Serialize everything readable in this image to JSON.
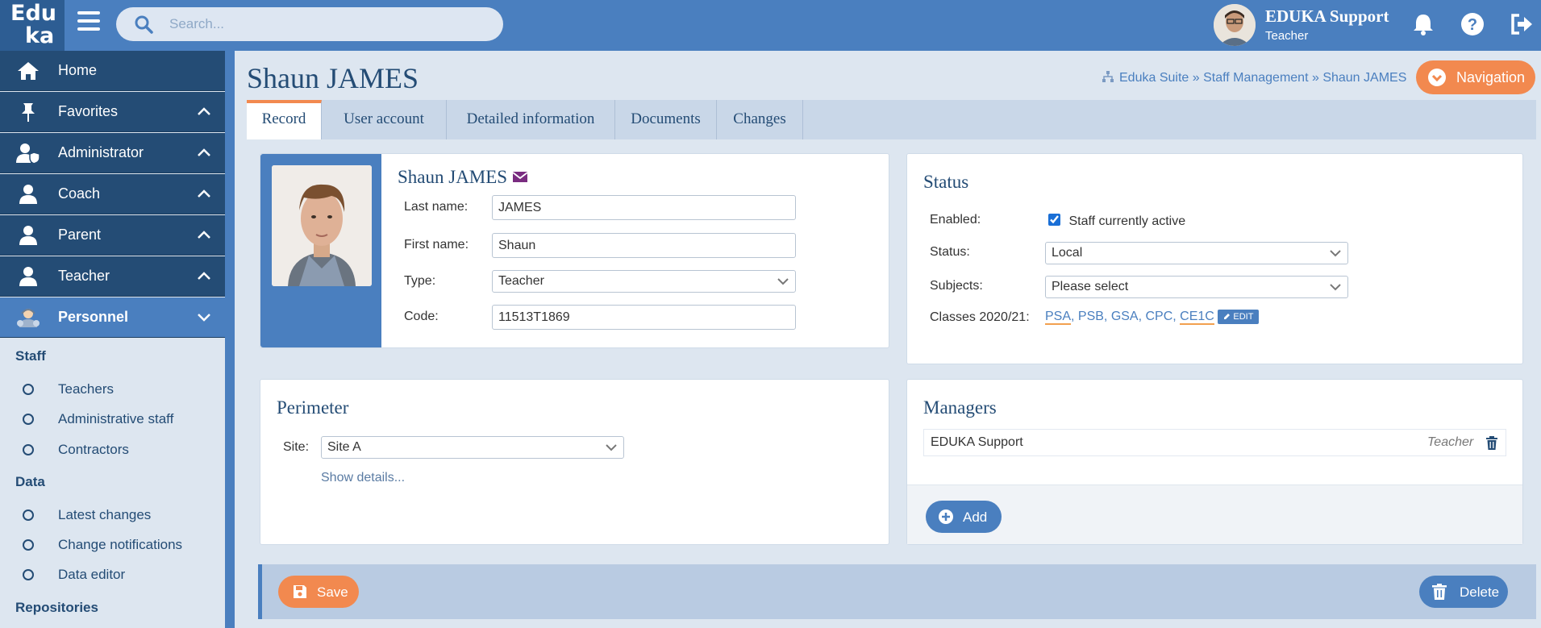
{
  "logo": {
    "line1": "Edu",
    "line2": "ka"
  },
  "search": {
    "placeholder": "Search..."
  },
  "user": {
    "name": "EDUKA Support",
    "role": "Teacher"
  },
  "sidebar": {
    "items": [
      {
        "label": "Home",
        "icon": "home-icon"
      },
      {
        "label": "Favorites",
        "icon": "pin-icon"
      },
      {
        "label": "Administrator",
        "icon": "user-shield-icon"
      },
      {
        "label": "Coach",
        "icon": "user-icon"
      },
      {
        "label": "Parent",
        "icon": "user-icon"
      },
      {
        "label": "Teacher",
        "icon": "user-icon"
      },
      {
        "label": "Personnel",
        "icon": "personnel-icon"
      }
    ],
    "groups": {
      "staff": "Staff",
      "data": "Data",
      "repositories": "Repositories"
    },
    "staff_items": [
      "Teachers",
      "Administrative staff",
      "Contractors"
    ],
    "data_items": [
      "Latest changes",
      "Change notifications",
      "Data editor"
    ]
  },
  "page": {
    "title": "Shaun JAMES"
  },
  "breadcrumb": "Eduka Suite » Staff Management » Shaun JAMES",
  "navigation_button": "Navigation",
  "tabs": [
    "Record",
    "User account",
    "Detailed information",
    "Documents",
    "Changes"
  ],
  "record": {
    "name": "Shaun JAMES",
    "last_name_label": "Last name:",
    "last_name": "JAMES",
    "first_name_label": "First name:",
    "first_name": "Shaun",
    "type_label": "Type:",
    "type": "Teacher",
    "code_label": "Code:",
    "code": "11513T1869"
  },
  "status": {
    "title": "Status",
    "enabled_label": "Enabled:",
    "enabled_text": "Staff currently active",
    "status_label": "Status:",
    "status_value": "Local",
    "subjects_label": "Subjects:",
    "subjects_value": "Please select",
    "classes_label": "Classes 2020/21:",
    "classes": [
      "PSA",
      "PSB",
      "GSA",
      "CPC",
      "CE1C"
    ],
    "edit_label": "EDIT"
  },
  "perimeter": {
    "title": "Perimeter",
    "site_label": "Site:",
    "site_value": "Site A",
    "details_link": "Show details..."
  },
  "managers": {
    "title": "Managers",
    "rows": [
      {
        "name": "EDUKA Support",
        "role": "Teacher"
      }
    ],
    "add_label": "Add"
  },
  "actions": {
    "save": "Save",
    "delete": "Delete"
  },
  "colors": {
    "primary": "#4a7fbf",
    "dark": "#244c75",
    "accent": "#f2894f",
    "background": "#dde6f0"
  }
}
